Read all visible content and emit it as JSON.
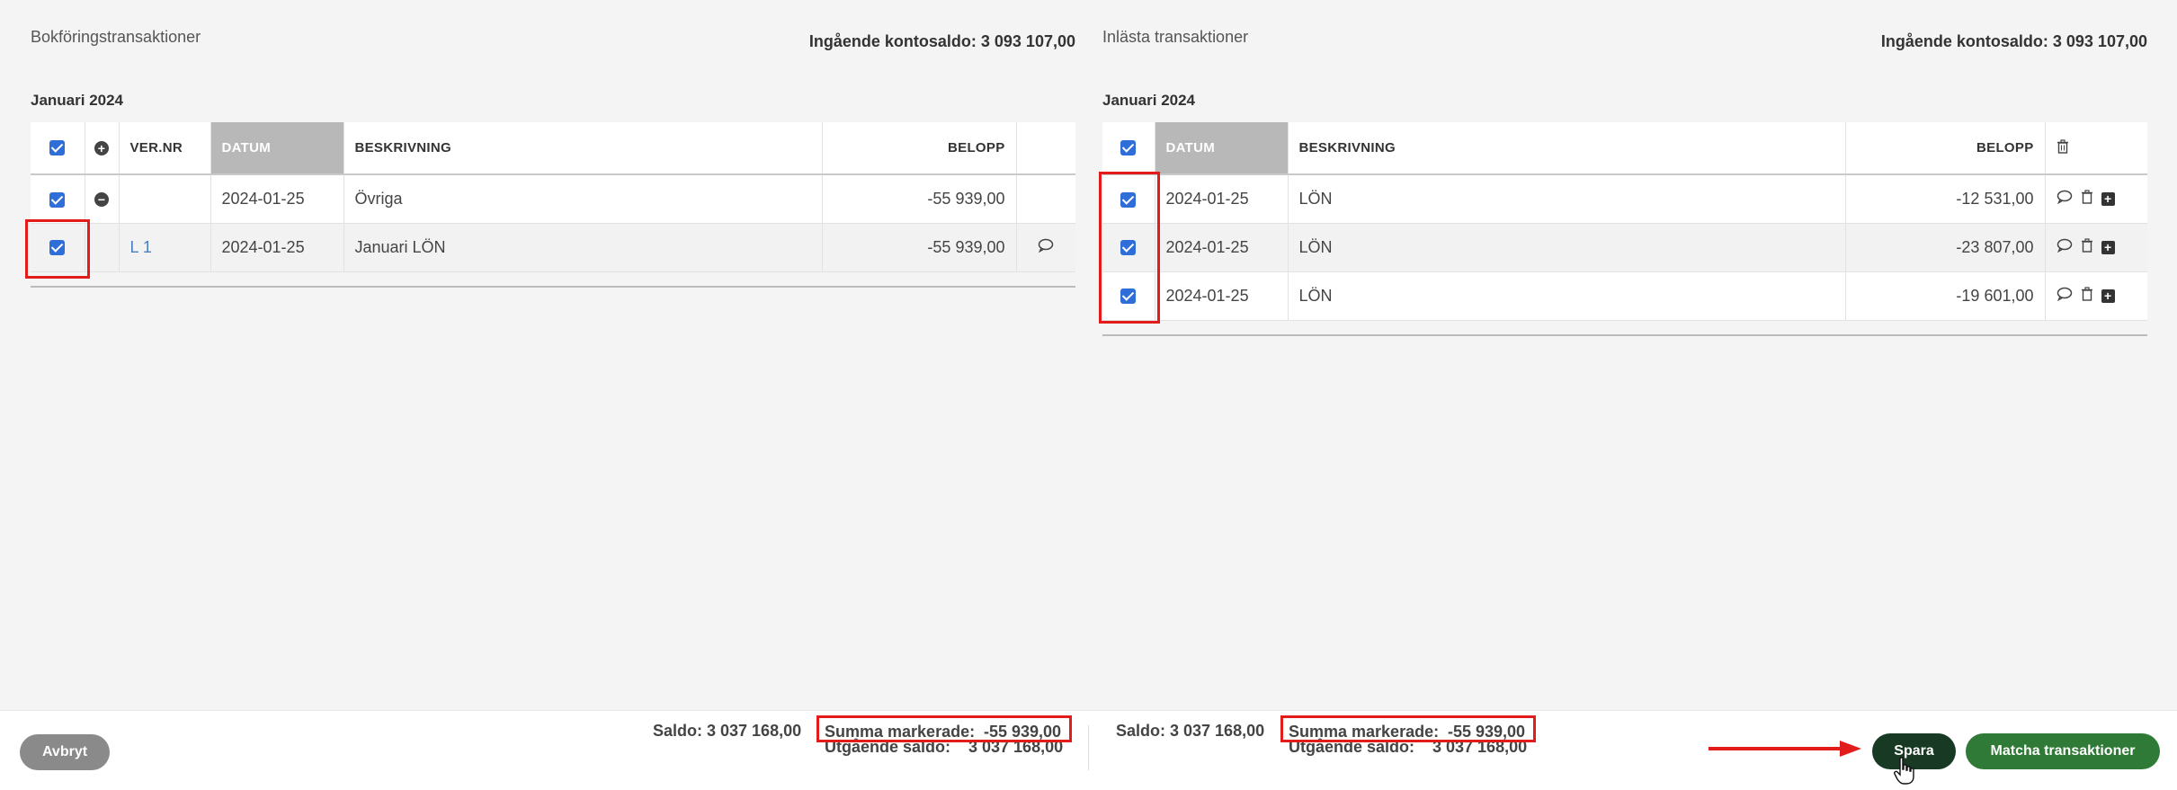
{
  "left": {
    "title": "Bokföringstransaktioner",
    "opening_balance": "Ingående kontosaldo: 3 093 107,00",
    "month": "Januari 2024",
    "columns": {
      "ver_nr": "VER.NR",
      "datum": "DATUM",
      "beskrivning": "BESKRIVNING",
      "belopp": "BELOPP"
    },
    "rows": [
      {
        "ver_nr": "",
        "datum": "2024-01-25",
        "beskrivning": "Övriga",
        "belopp": "-55 939,00"
      },
      {
        "ver_nr": "L 1",
        "datum": "2024-01-25",
        "beskrivning": "Januari LÖN",
        "belopp": "-55 939,00"
      }
    ]
  },
  "right": {
    "title": "Inlästa transaktioner",
    "opening_balance": "Ingående kontosaldo: 3 093 107,00",
    "month": "Januari 2024",
    "columns": {
      "datum": "DATUM",
      "beskrivning": "BESKRIVNING",
      "belopp": "BELOPP"
    },
    "rows": [
      {
        "datum": "2024-01-25",
        "beskrivning": "LÖN",
        "belopp": "-12 531,00"
      },
      {
        "datum": "2024-01-25",
        "beskrivning": "LÖN",
        "belopp": "-23 807,00"
      },
      {
        "datum": "2024-01-25",
        "beskrivning": "LÖN",
        "belopp": "-19 601,00"
      }
    ]
  },
  "footer": {
    "cancel_label": "Avbryt",
    "left": {
      "saldo": "Saldo: 3 037 168,00",
      "summa_label": "Summa markerade:",
      "summa_value": "-55 939,00",
      "utgaende_label": "Utgående saldo:",
      "utgaende_value": "3 037 168,00"
    },
    "right": {
      "saldo": "Saldo: 3 037 168,00",
      "summa_label": "Summa markerade:",
      "summa_value": "-55 939,00",
      "utgaende_label": "Utgående saldo:",
      "utgaende_value": "3 037 168,00"
    },
    "save_label": "Spara",
    "match_label": "Matcha transaktioner"
  },
  "colors": {
    "highlight": "#e21b1b",
    "save_button": "#183a24",
    "match_button": "#2f7a36",
    "checkbox": "#2f6ed8"
  }
}
